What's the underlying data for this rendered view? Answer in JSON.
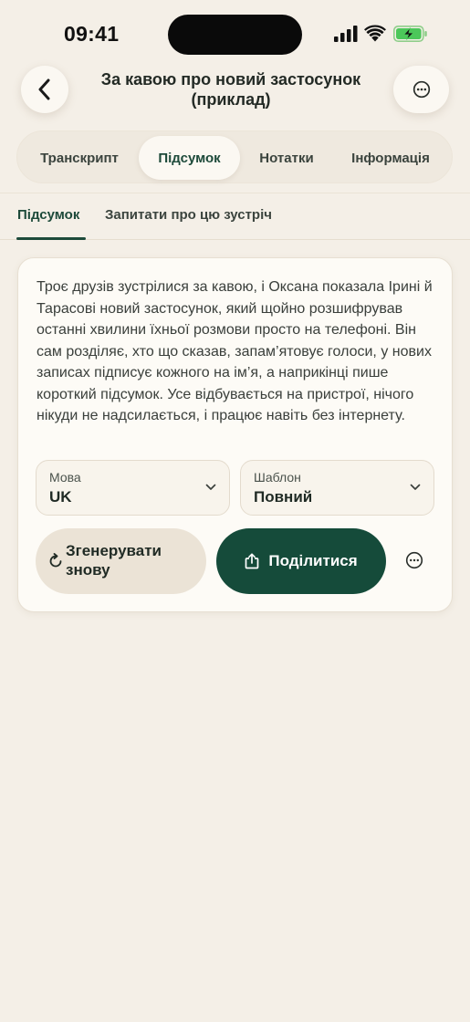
{
  "status": {
    "time": "09:41"
  },
  "header": {
    "back_icon": "chevron-left-icon",
    "title": "За кавою про новий застосунок (приклад)",
    "more_icon": "ellipsis-circle-icon"
  },
  "tabs": [
    {
      "label": "Транскрипт",
      "active": false
    },
    {
      "label": "Підсумок",
      "active": true
    },
    {
      "label": "Нотатки",
      "active": false
    },
    {
      "label": "Інформація",
      "active": false
    }
  ],
  "subtabs": [
    {
      "label": "Підсумок",
      "active": true
    },
    {
      "label": "Запитати про цю зустріч",
      "active": false
    }
  ],
  "summary": {
    "text": "Троє друзів зустрілися за кавою, і Оксана показала Ірині й Тарасові новий застосунок, який щойно розшифрував останні хвилини їхньої розмови просто на телефоні. Він сам розділяє, хто що сказав, запам’ятовує голоси, у нових записах підписує кожного на ім’я, а наприкінці пише короткий підсумок. Усе відбувається на пристрої, нічого нікуди не надсилається, і працює навіть без інтернету.",
    "language": {
      "label": "Мова",
      "value": "UK"
    },
    "template": {
      "label": "Шаблон",
      "value": "Повний"
    },
    "regenerate_label": "Згенерувати знову",
    "share_label": "Поділитися"
  },
  "colors": {
    "background": "#f4efe7",
    "accent": "#154b3a",
    "secondary_button": "#ebe3d6"
  }
}
